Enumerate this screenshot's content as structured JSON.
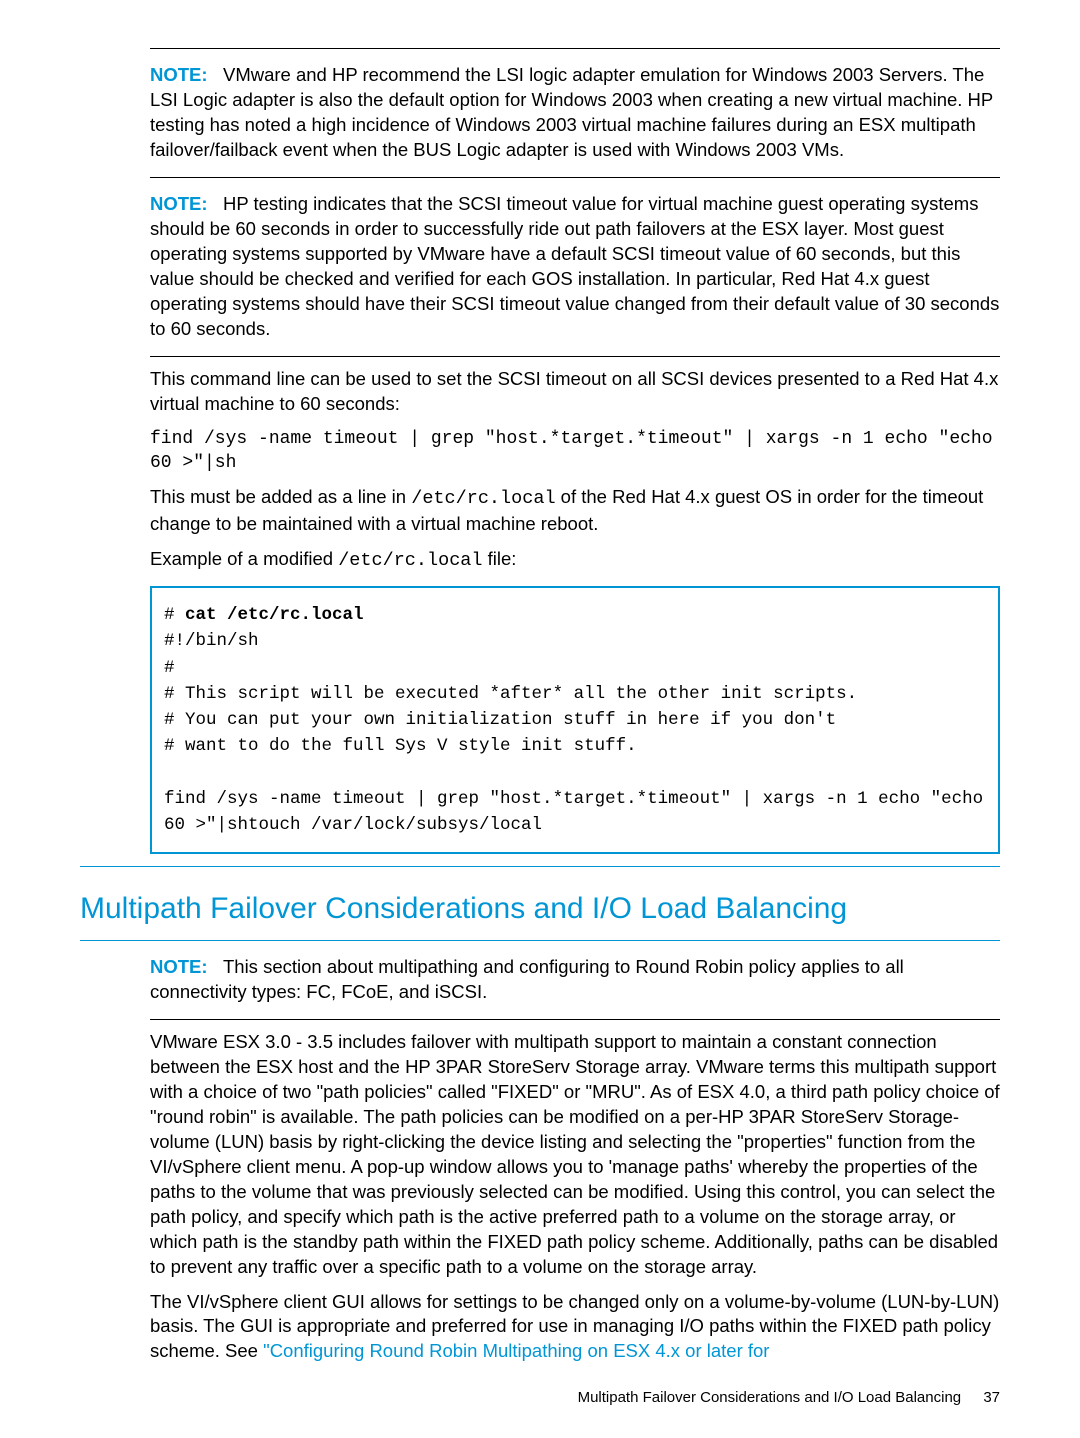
{
  "notes": {
    "n1_label": "NOTE:",
    "n1_text": "VMware and HP recommend the LSI logic adapter emulation for Windows 2003 Servers. The LSI Logic adapter is also the default option for Windows 2003 when creating a new virtual machine. HP testing has noted a high incidence of Windows 2003 virtual machine failures during an ESX multipath failover/failback event when the BUS Logic adapter is used with Windows 2003 VMs.",
    "n2_label": "NOTE:",
    "n2_text": "HP testing indicates that the SCSI timeout value for virtual machine guest operating systems should be 60 seconds in order to successfully ride out path failovers at the ESX layer. Most guest operating systems supported by VMware have a default SCSI timeout value of 60 seconds, but this value should be checked and verified for each GOS installation. In particular, Red Hat 4.x guest operating systems should have their SCSI timeout value changed from their default value of 30 seconds to 60 seconds.",
    "n3_label": "NOTE:",
    "n3_text": "This section about multipathing and configuring to Round Robin policy applies to all connectivity types: FC, FCoE, and iSCSI."
  },
  "paras": {
    "p1": "This command line can be used to set the SCSI timeout on all SCSI devices presented to a Red Hat 4.x virtual machine to 60 seconds:",
    "cmd1": "find /sys -name timeout | grep \"host.*target.*timeout\" | xargs -n 1 echo \"echo 60 >\"|sh",
    "p2a": "This must be added as a line in ",
    "p2_code": "/etc/rc.local",
    "p2b": " of the Red Hat 4.x guest OS in order for the timeout change to be maintained with a virtual machine reboot.",
    "p3a": "Example of a modified ",
    "p3_code": "/etc/rc.local",
    "p3b": " file:",
    "p4": "VMware ESX 3.0 - 3.5 includes failover with multipath support to maintain a constant connection between the ESX host and the HP 3PAR StoreServ Storage array. VMware terms this multipath support with a choice of two \"path policies\" called \"FIXED\" or \"MRU\". As of ESX 4.0, a third path policy choice of \"round robin\" is available. The path policies can be modified on a per-HP 3PAR StoreServ Storage-volume (LUN) basis by right-clicking the device listing and selecting the \"properties\" function from the VI/vSphere client menu. A pop-up window allows you to 'manage paths' whereby the properties of the paths to the volume that was previously selected can be modified. Using this control, you can select the path policy, and specify which path is the active preferred path to a volume on the storage array, or which path is the standby path within the FIXED path policy scheme. Additionally, paths can be disabled to prevent any traffic over a specific path to a volume on the storage array.",
    "p5a": "The VI/vSphere client GUI allows for settings to be changed only on a volume-by-volume (LUN-by-LUN) basis. The GUI is appropriate and preferred for use in managing I/O paths within the FIXED path policy scheme. See ",
    "p5_link": "\"Configuring Round Robin Multipathing on ESX 4.x or later for"
  },
  "code": {
    "l1": "# ",
    "l1b": "cat /etc/rc.local",
    "l2": "#!/bin/sh",
    "l3": "#",
    "l4": "# This script will be executed *after* all the other init scripts.",
    "l5": "# You can put your own initialization stuff in here if you don't",
    "l6": "# want to do the full Sys V style init stuff.",
    "l7": "find /sys -name timeout | grep \"host.*target.*timeout\" | xargs -n 1 echo \"echo 60 >\"|shtouch /var/lock/subsys/local"
  },
  "heading": "Multipath Failover Considerations and I/O Load Balancing",
  "footer": {
    "text": "Multipath Failover Considerations and I/O Load Balancing",
    "page": "37"
  }
}
